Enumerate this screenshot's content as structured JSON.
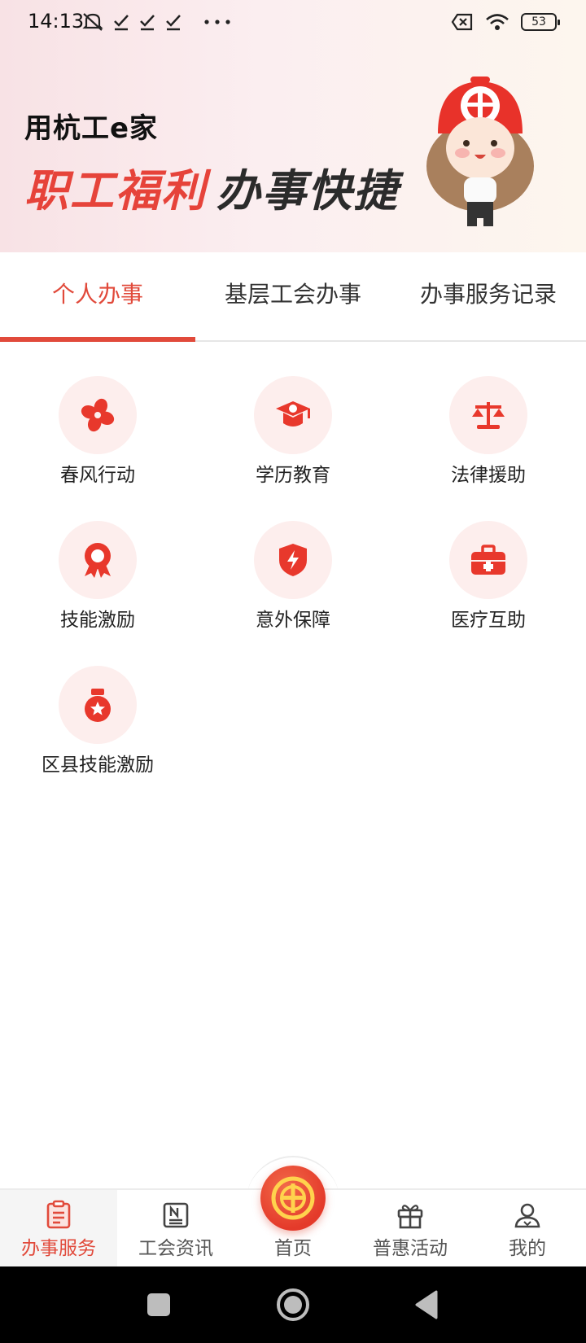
{
  "status_bar": {
    "time": "14:13",
    "battery": "53"
  },
  "banner": {
    "subtitle": "用杭工e家",
    "title_red": "职工福利",
    "title_dark": "办事快捷"
  },
  "tabs": [
    {
      "label": "个人办事",
      "active": true
    },
    {
      "label": "基层工会办事",
      "active": false
    },
    {
      "label": "办事服务记录",
      "active": false
    }
  ],
  "services": [
    {
      "label": "春风行动",
      "icon": "fan-flower-icon"
    },
    {
      "label": "学历教育",
      "icon": "graduation-cap-icon"
    },
    {
      "label": "法律援助",
      "icon": "scales-icon"
    },
    {
      "label": "技能激励",
      "icon": "award-ribbon-icon"
    },
    {
      "label": "意外保障",
      "icon": "shield-lightning-icon"
    },
    {
      "label": "医疗互助",
      "icon": "medical-kit-icon"
    },
    {
      "label": "区县技能激励",
      "icon": "medal-icon"
    }
  ],
  "bottom_nav": [
    {
      "label": "办事服务",
      "active": true
    },
    {
      "label": "工会资讯",
      "active": false
    },
    {
      "label": "首页",
      "active": false
    },
    {
      "label": "普惠活动",
      "active": false
    },
    {
      "label": "我的",
      "active": false
    }
  ],
  "colors": {
    "accent": "#e14a3b",
    "icon_bg": "#fdeeed",
    "banner_bg": "#f8e2e5"
  }
}
